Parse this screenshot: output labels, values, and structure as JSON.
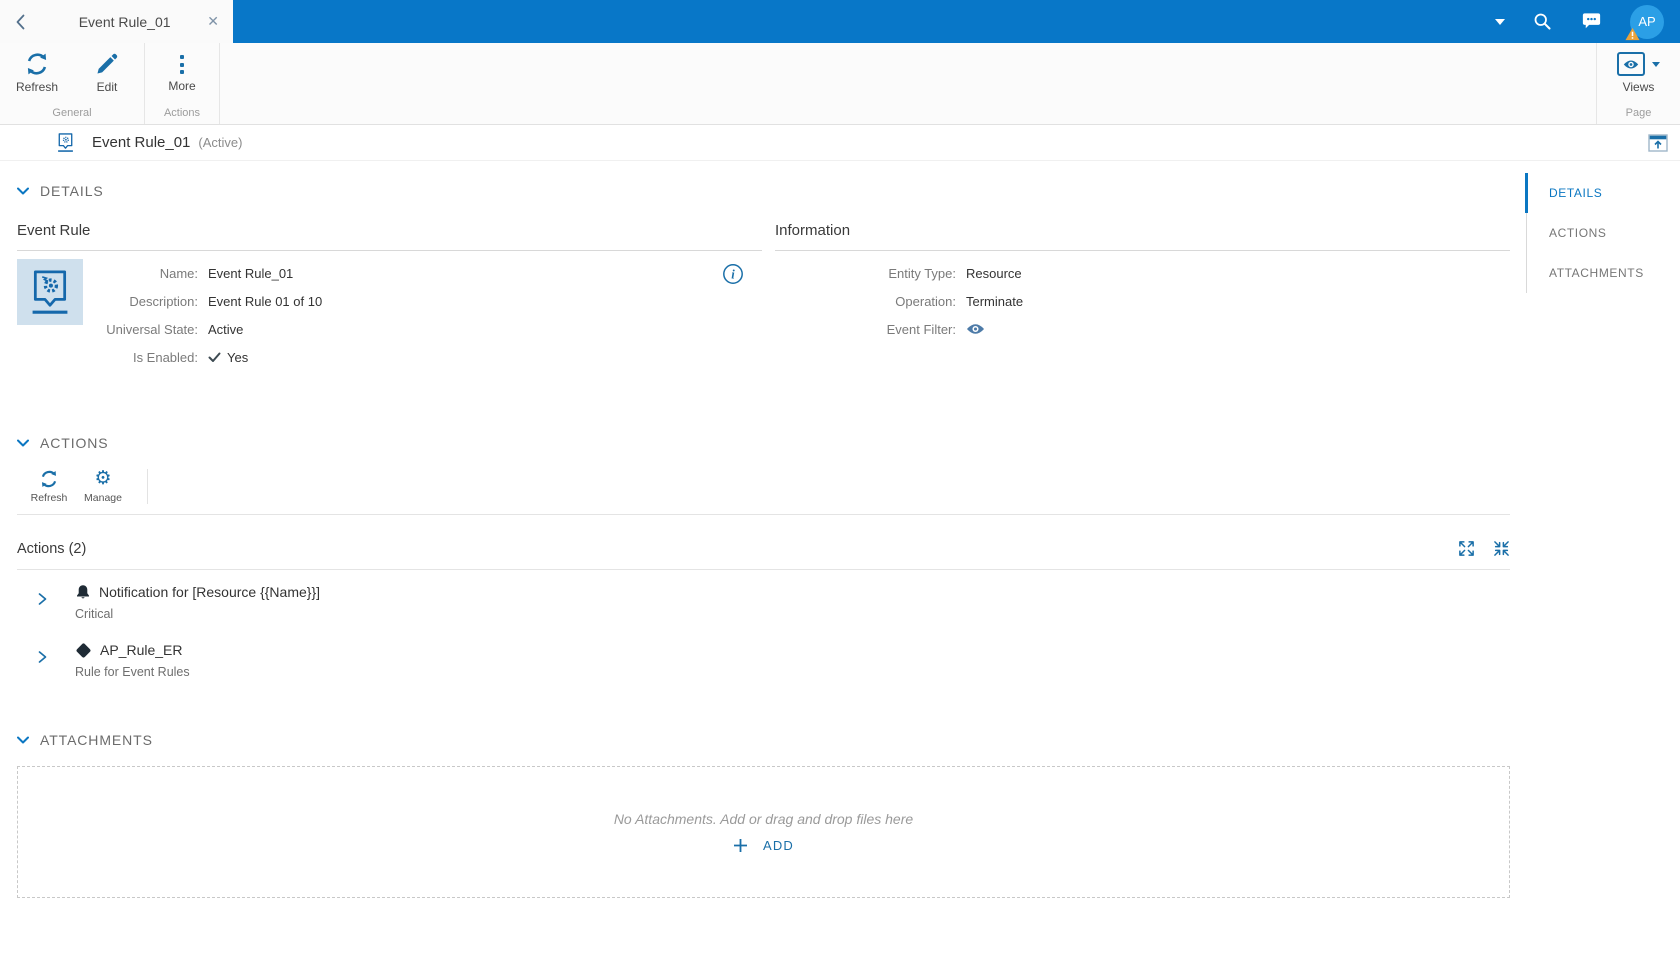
{
  "colors": {
    "header_blue": "#0877c8",
    "accent_blue": "#1a6fa8",
    "nav_active_blue": "#0b77c2",
    "avatar_blue": "#2b9fe6",
    "warning_orange": "#e8a33d",
    "tile_bg": "#cfe0ed"
  },
  "header": {
    "tab_title": "Event Rule_01",
    "close_glyph": "✕",
    "avatar_initials": "AP"
  },
  "ribbon": {
    "groups": [
      {
        "label": "General",
        "buttons": [
          {
            "label": "Refresh"
          },
          {
            "label": "Edit"
          }
        ]
      },
      {
        "label": "Actions",
        "buttons": [
          {
            "label": "More"
          }
        ]
      }
    ],
    "page_group": {
      "button_label": "Views",
      "label": "Page"
    }
  },
  "titlebar": {
    "title": "Event Rule_01",
    "state": "(Active)"
  },
  "details": {
    "section_label": "DETAILS",
    "event_rule": {
      "heading": "Event Rule",
      "fields": [
        {
          "label": "Name:",
          "value": "Event Rule_01"
        },
        {
          "label": "Description:",
          "value": "Event Rule 01 of 10"
        },
        {
          "label": "Universal State:",
          "value": "Active"
        },
        {
          "label": "Is Enabled:",
          "value": "Yes"
        }
      ]
    },
    "information": {
      "heading": "Information",
      "fields": [
        {
          "label": "Entity Type:",
          "value": "Resource"
        },
        {
          "label": "Operation:",
          "value": "Terminate"
        },
        {
          "label": "Event Filter:",
          "value": ""
        }
      ]
    }
  },
  "actions": {
    "section_label": "ACTIONS",
    "toolbar": [
      {
        "label": "Refresh"
      },
      {
        "label": "Manage"
      }
    ],
    "list_title": "Actions (2)",
    "items": [
      {
        "title": "Notification for [Resource {{Name}}]",
        "subtitle": "Critical"
      },
      {
        "title": "AP_Rule_ER",
        "subtitle": "Rule for Event Rules"
      }
    ]
  },
  "attachments": {
    "section_label": "ATTACHMENTS",
    "empty_text": "No Attachments. Add or drag and drop files here",
    "add_label": "ADD"
  },
  "side_nav": {
    "items": [
      {
        "label": "DETAILS"
      },
      {
        "label": "ACTIONS"
      },
      {
        "label": "ATTACHMENTS"
      }
    ]
  }
}
